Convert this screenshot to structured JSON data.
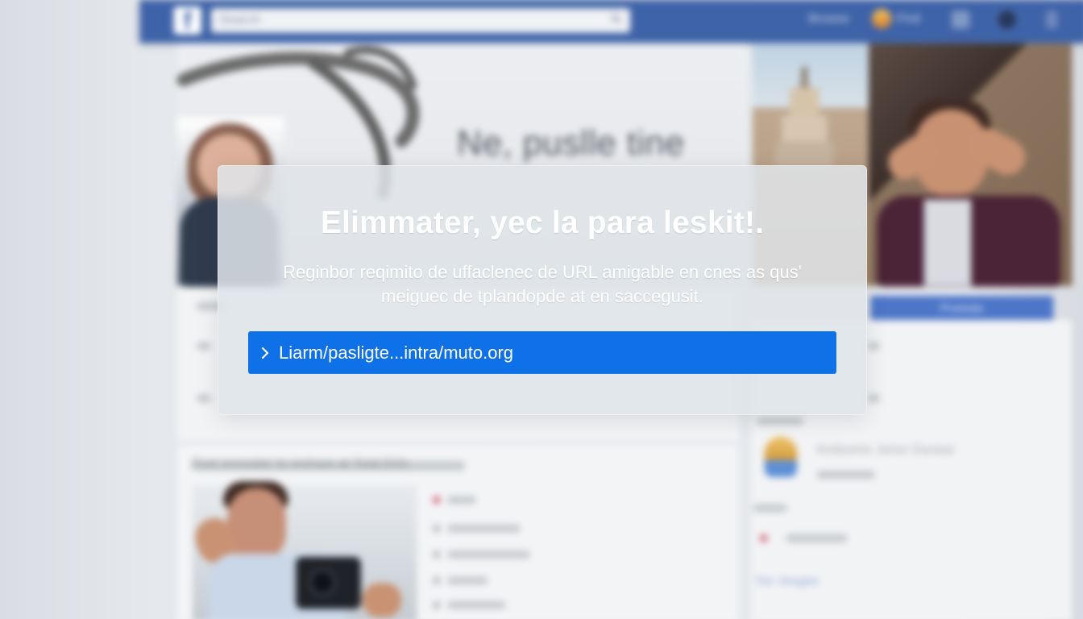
{
  "background": {
    "cover_title": "Ne, puslle tine",
    "search_placeholder": "Search",
    "top_links": [
      "Browse",
      "Find"
    ],
    "side_button_label": "Promote",
    "feed_heading": "Post reminder to reshare at Total EDs",
    "contact_name": "Kirdoomn Jonor Dunear",
    "link_text": "Ton Vesgee"
  },
  "dialog": {
    "title": "Elimmater, yec la para leskit!.",
    "message_line_1": "Reginbor reqimito de uffaclenec de URL amigable en cnes as qus'",
    "message_line_2": "meiguec de tplandopde at en saccegusit.",
    "url_label": "Liarm/pasligte...intra/muto.org"
  },
  "colors": {
    "facebook_blue": "#3f63a8",
    "dialog_button": "#0f71e8",
    "overlay_bg": "#e0e4e9"
  },
  "icons": {
    "facebook": "facebook-icon",
    "search": "search-icon",
    "chevron": "chevron-right-icon"
  }
}
